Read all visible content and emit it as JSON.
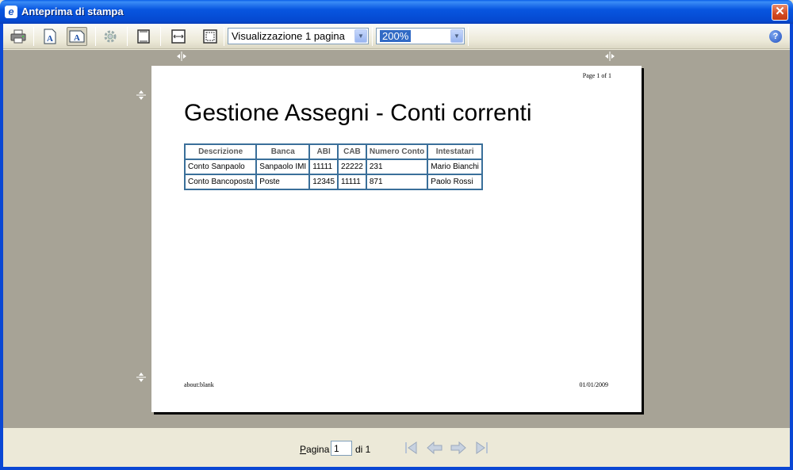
{
  "window": {
    "title": "Anteprima di stampa",
    "close_glyph": "✕",
    "app_icon_glyph": "e"
  },
  "toolbar": {
    "view_mode_value": "Visualizzazione 1 pagina",
    "zoom_value": "200%",
    "help_glyph": "?"
  },
  "page": {
    "header_text": "Page 1 of 1",
    "title": "Gestione Assegni - Conti correnti",
    "table": {
      "headers": [
        "Descrizione",
        "Banca",
        "ABI",
        "CAB",
        "Numero Conto",
        "Intestatari"
      ],
      "rows": [
        [
          "Conto Sanpaolo",
          "Sanpaolo IMI",
          "11111",
          "22222",
          "231",
          "Mario Bianchi"
        ],
        [
          "Conto Bancoposta",
          "Poste",
          "12345",
          "11111",
          "871",
          "Paolo Rossi"
        ]
      ]
    },
    "footer_left": "about:blank",
    "footer_right": "01/01/2009"
  },
  "pager": {
    "label_prefix": "P",
    "label_rest": "agina",
    "current_page": "1",
    "total_text": "di 1"
  },
  "colors": {
    "title_bar": "#0856e0",
    "preview_background": "#a7a396",
    "table_border": "#3a6f9a"
  }
}
